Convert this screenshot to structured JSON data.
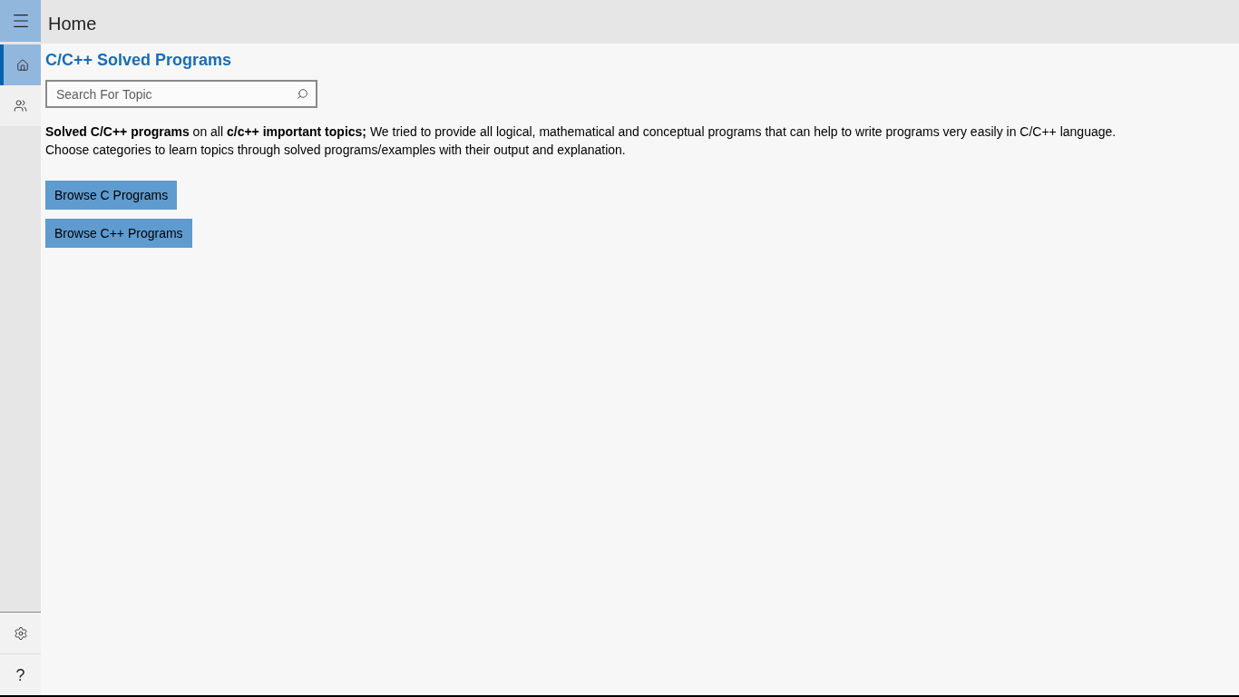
{
  "header": {
    "title": "Home"
  },
  "nav": {
    "items": [
      {
        "kind": "home",
        "selected": true
      },
      {
        "kind": "people",
        "selected": false
      }
    ],
    "footer_items": [
      {
        "kind": "settings"
      },
      {
        "kind": "help",
        "glyph": "?"
      }
    ]
  },
  "page": {
    "heading": "C/C++ Solved Programs",
    "search": {
      "placeholder": "Search For Topic"
    },
    "intro": [
      "**Solved C/C++ programs** on all **c/c++ important topics;** We tried to provide all logical, mathematical and conceptual programs that can help to write programs very easily in C/C++ language.",
      "Choose categories to learn topics through solved programs/examples with their output and explanation."
    ],
    "buttons": [
      "Browse C Programs",
      "Browse C++ Programs"
    ]
  }
}
